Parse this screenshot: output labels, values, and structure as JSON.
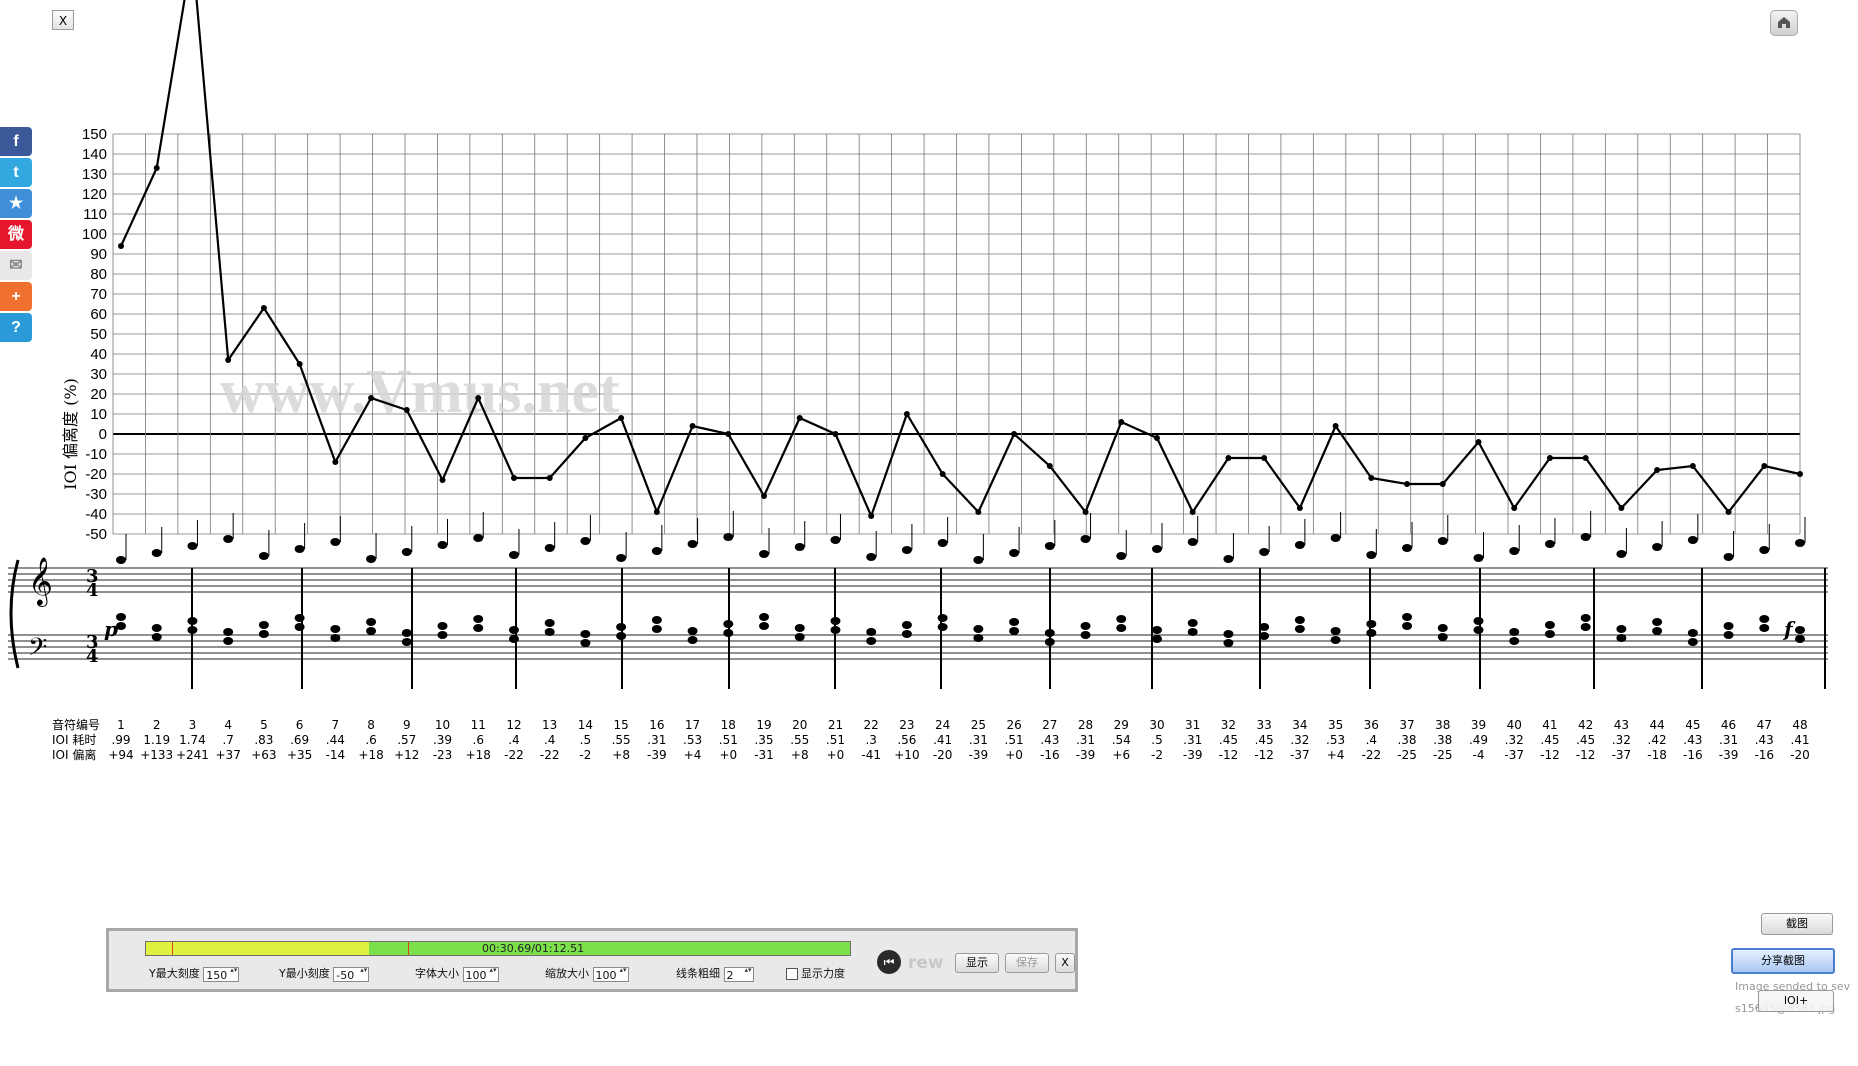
{
  "window": {
    "close_label": "X"
  },
  "social_icons": [
    {
      "name": "facebook-icon",
      "glyph": "f",
      "color": "#3b5998"
    },
    {
      "name": "twitter-icon",
      "glyph": "t",
      "color": "#33a7e0"
    },
    {
      "name": "favorite-star-icon",
      "glyph": "★",
      "color": "#3f8fd8"
    },
    {
      "name": "weibo-icon",
      "glyph": "微",
      "color": "#e6162d"
    },
    {
      "name": "mail-icon",
      "glyph": "✉",
      "color": "#e8e8e8"
    },
    {
      "name": "add-share-icon",
      "glyph": "+",
      "color": "#f07030"
    },
    {
      "name": "help-icon",
      "glyph": "?",
      "color": "#2a9ad8"
    }
  ],
  "chart_data": {
    "type": "line",
    "ylabel": "IOI 偏离度 (%)",
    "ylim": [
      -50,
      150
    ],
    "ytick_step": 10,
    "grid": true,
    "watermark": "www.Vmus.net",
    "row_labels": [
      "音符编号",
      "IOI 耗时",
      "IOI 偏离"
    ],
    "notes": [
      "1",
      "2",
      "3",
      "4",
      "5",
      "6",
      "7",
      "8",
      "9",
      "10",
      "11",
      "12",
      "13",
      "14",
      "15",
      "16",
      "17",
      "18",
      "19",
      "20",
      "21",
      "22",
      "23",
      "24",
      "25",
      "26",
      "27",
      "28",
      "29",
      "30",
      "31",
      "32",
      "33",
      "34",
      "35",
      "36",
      "37",
      "38",
      "39",
      "40",
      "41",
      "42",
      "43",
      "44",
      "45",
      "46",
      "47",
      "48"
    ],
    "ioi_time": [
      ".99",
      "1.19",
      "1.74",
      ".7",
      ".83",
      ".69",
      ".44",
      ".6",
      ".57",
      ".39",
      ".6",
      ".4",
      ".4",
      ".5",
      ".55",
      ".31",
      ".53",
      ".51",
      ".35",
      ".55",
      ".51",
      ".3",
      ".56",
      ".41",
      ".31",
      ".51",
      ".43",
      ".31",
      ".54",
      ".5",
      ".31",
      ".45",
      ".45",
      ".32",
      ".53",
      ".4",
      ".38",
      ".38",
      ".49",
      ".32",
      ".45",
      ".45",
      ".32",
      ".42",
      ".43",
      ".31",
      ".43",
      ".41"
    ],
    "ioi_dev_labels": [
      "+94",
      "+133",
      "+241",
      "+37",
      "+63",
      "+35",
      "-14",
      "+18",
      "+12",
      "-23",
      "+18",
      "-22",
      "-22",
      "-2",
      "+8",
      "-39",
      "+4",
      "+0",
      "-31",
      "+8",
      "+0",
      "-41",
      "+10",
      "-20",
      "-39",
      "+0",
      "-16",
      "-39",
      "+6",
      "-2",
      "-39",
      "-12",
      "-12",
      "-37",
      "+4",
      "-22",
      "-25",
      "-25",
      "-4",
      "-37",
      "-12",
      "-12",
      "-37",
      "-18",
      "-16",
      "-39",
      "-16",
      "-20"
    ],
    "series": [
      {
        "values": [
          94,
          133,
          241,
          37,
          63,
          35,
          -14,
          18,
          12,
          -23,
          18,
          -22,
          -22,
          -2,
          8,
          -39,
          4,
          0,
          -31,
          8,
          0,
          -41,
          10,
          -20,
          -39,
          0,
          -16,
          -39,
          6,
          -2,
          -39,
          -12,
          -12,
          -37,
          4,
          -22,
          -25,
          -25,
          -4,
          -37,
          -12,
          -12,
          -37,
          -18,
          -16,
          -39,
          -16,
          -20
        ]
      }
    ]
  },
  "score": {
    "time_signature": "3/4",
    "dynamic_start": "p",
    "dynamic_end": "f"
  },
  "control_panel": {
    "progress_fraction": 0.317,
    "time_display": "00:30.69/01:12.51",
    "y_max_label": "Y最大刻度",
    "y_max_value": "150",
    "y_min_label": "Y最小刻度",
    "y_min_value": "-50",
    "font_size_label": "字体大小",
    "font_size_value": "100",
    "zoom_label": "缩放大小",
    "zoom_value": "100",
    "line_width_label": "线条粗细",
    "line_width_value": "2",
    "show_force_label": "显示力度",
    "rew_label": "rew",
    "show_button": "显示",
    "save_button": "保存",
    "close_button": "X"
  },
  "sidebar": {
    "screenshot_button": "截图",
    "share_screenshot_button": "分享截图",
    "status_text_1": "Image sended to sev",
    "status_text_2": "s15605@8383.jpg",
    "ioi_plus_button": "IOI+"
  }
}
